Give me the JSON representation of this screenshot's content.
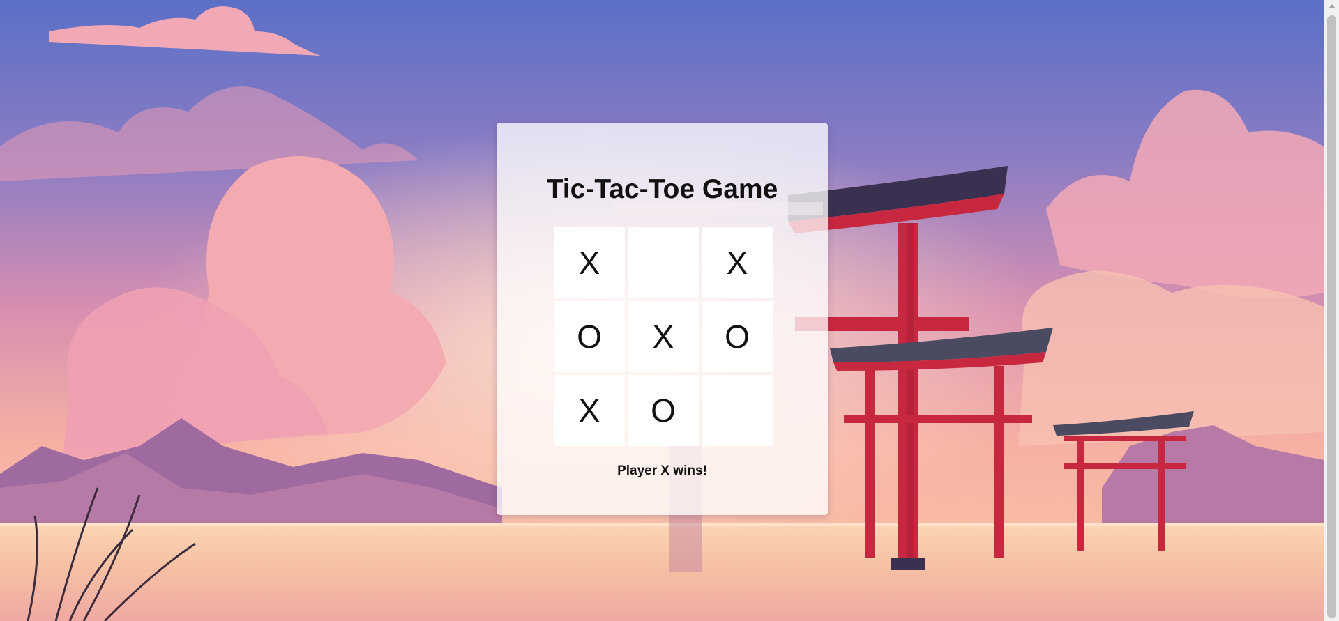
{
  "game": {
    "title": "Tic-Tac-Toe Game",
    "board": [
      [
        "X",
        "",
        "X"
      ],
      [
        "O",
        "X",
        "O"
      ],
      [
        "X",
        "O",
        ""
      ]
    ],
    "status": "Player X wins!"
  },
  "colors": {
    "sky_top": "#5b6fc6",
    "sky_mid": "#c98ab8",
    "horizon": "#f6b59a",
    "water": "#f5c6a3",
    "torii_red": "#c8283f",
    "torii_roof": "#3a3150",
    "card_bg": "#ffffff"
  }
}
